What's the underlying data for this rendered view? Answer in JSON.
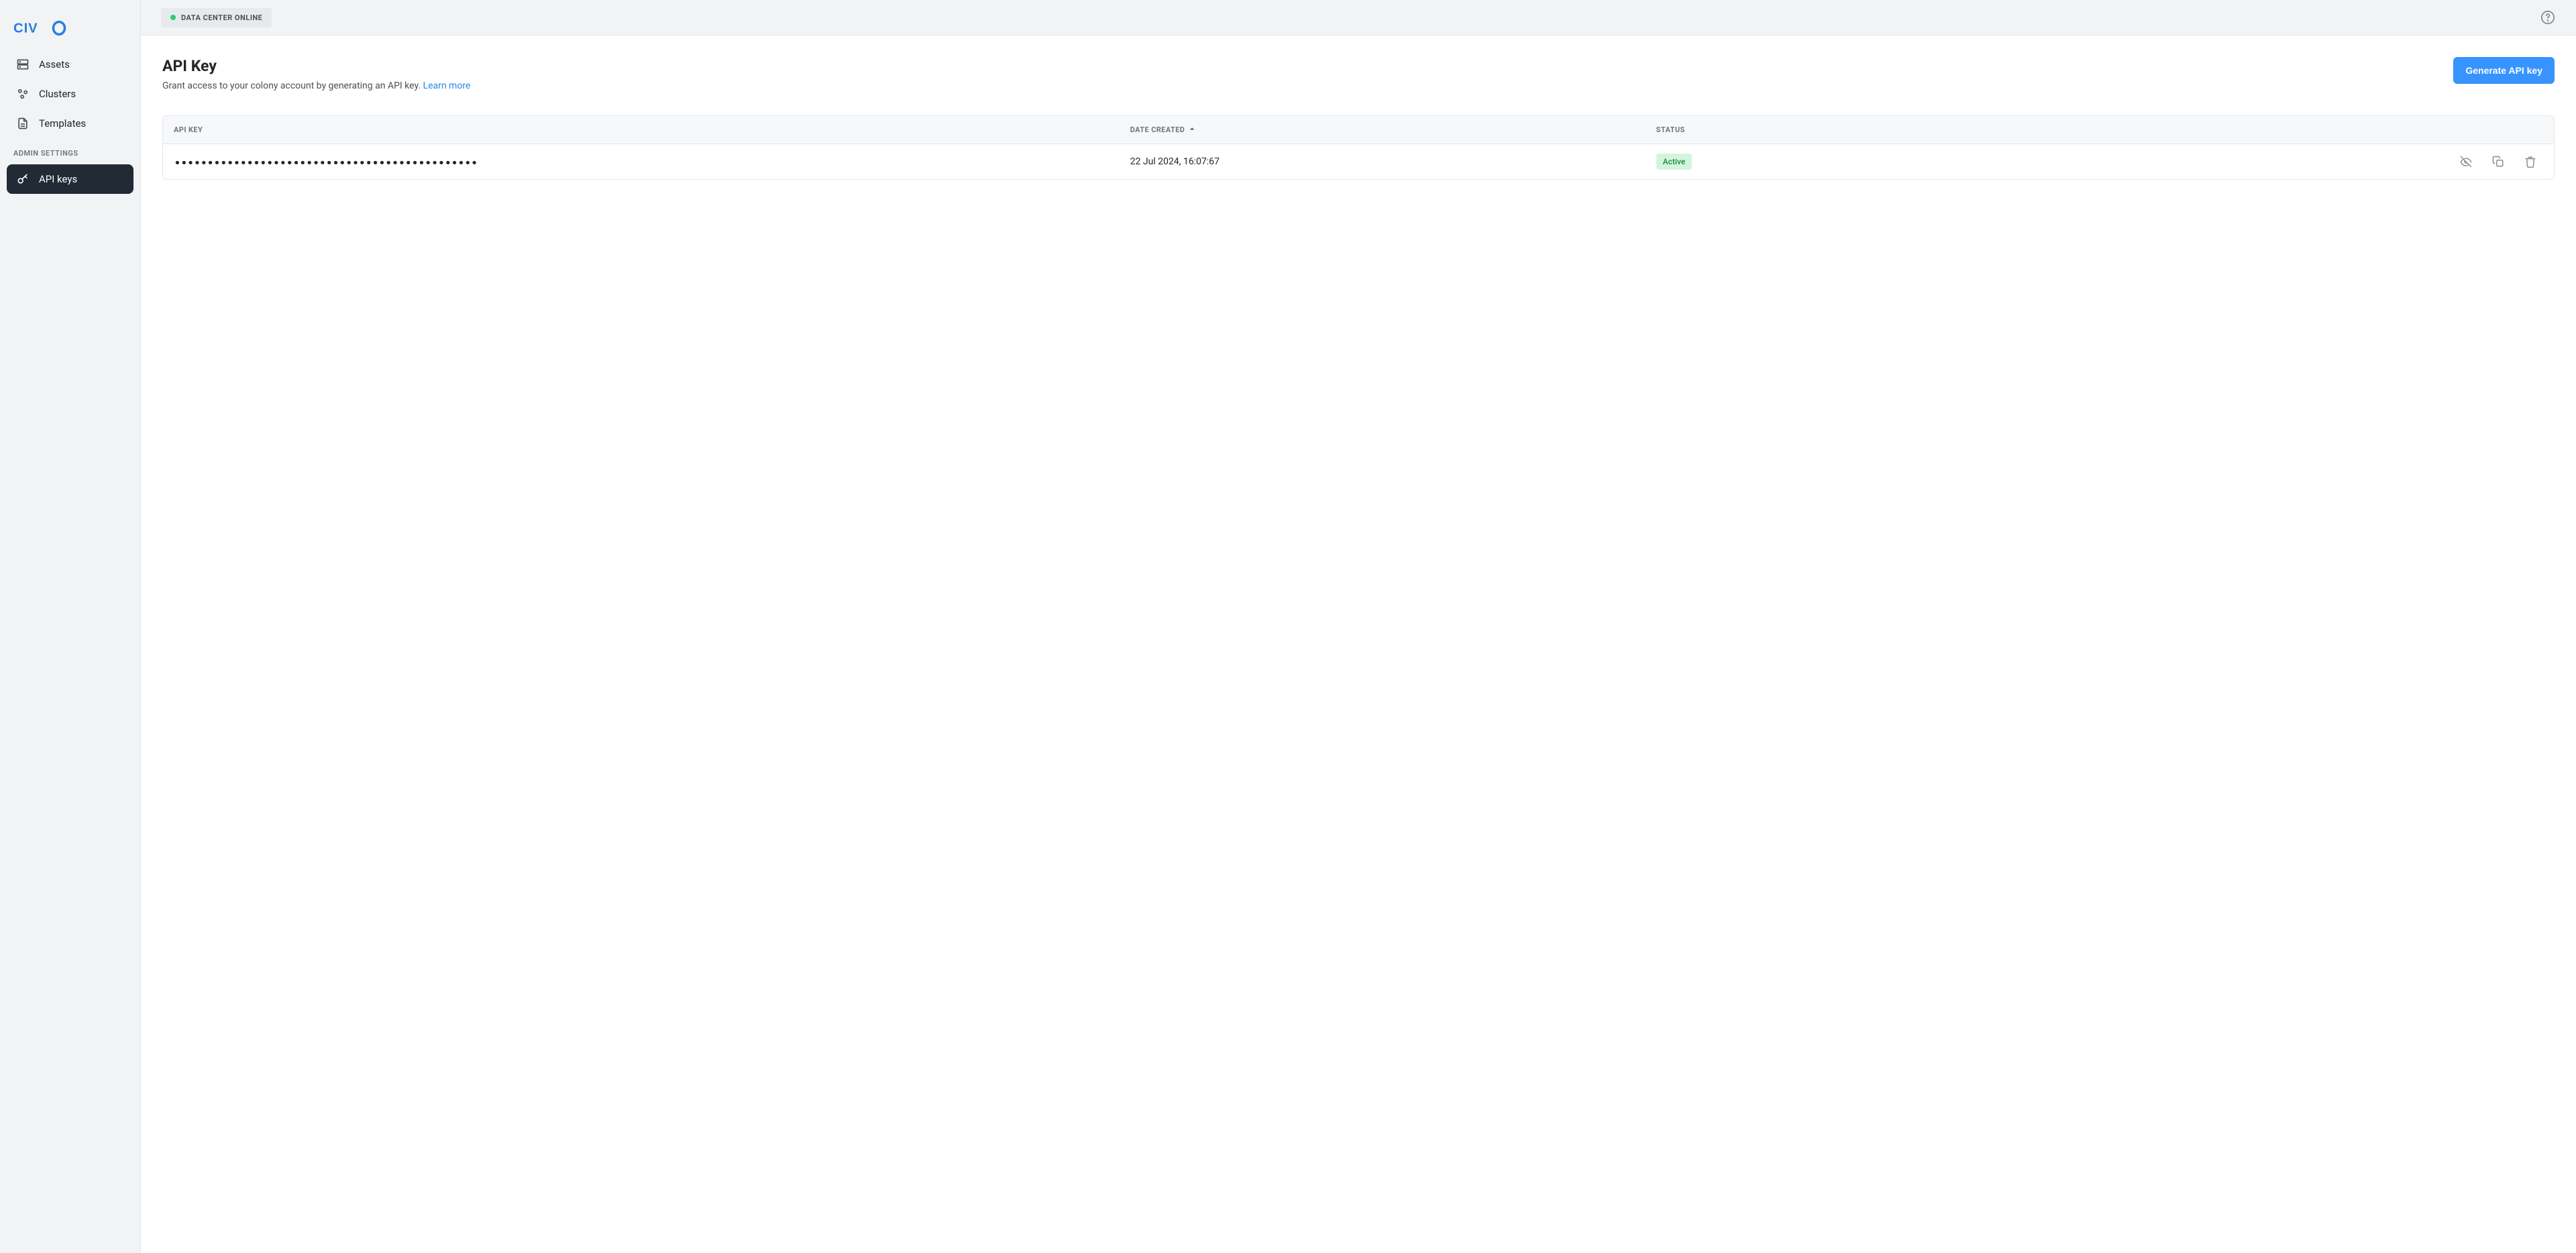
{
  "brand": {
    "name": "CIVO",
    "color": "#2a7de1"
  },
  "topbar": {
    "status_text": "DATA CENTER ONLINE"
  },
  "sidebar": {
    "items": [
      {
        "label": "Assets"
      },
      {
        "label": "Clusters"
      },
      {
        "label": "Templates"
      }
    ],
    "section_label": "ADMIN SETTINGS",
    "admin_items": [
      {
        "label": "API keys"
      }
    ]
  },
  "page": {
    "title": "API Key",
    "description_prefix": "Grant access to your colony account by generating an API key. ",
    "learn_more": "Learn more",
    "generate_label": "Generate API key"
  },
  "table": {
    "columns": {
      "api_key": "API KEY",
      "date_created": "DATE CREATED",
      "status": "STATUS"
    },
    "rows": [
      {
        "key_masked": "••••••••••••••••••••••••••••••••••••••••••••••",
        "date": "22 Jul 2024, 16:07:67",
        "status": "Active"
      }
    ]
  }
}
